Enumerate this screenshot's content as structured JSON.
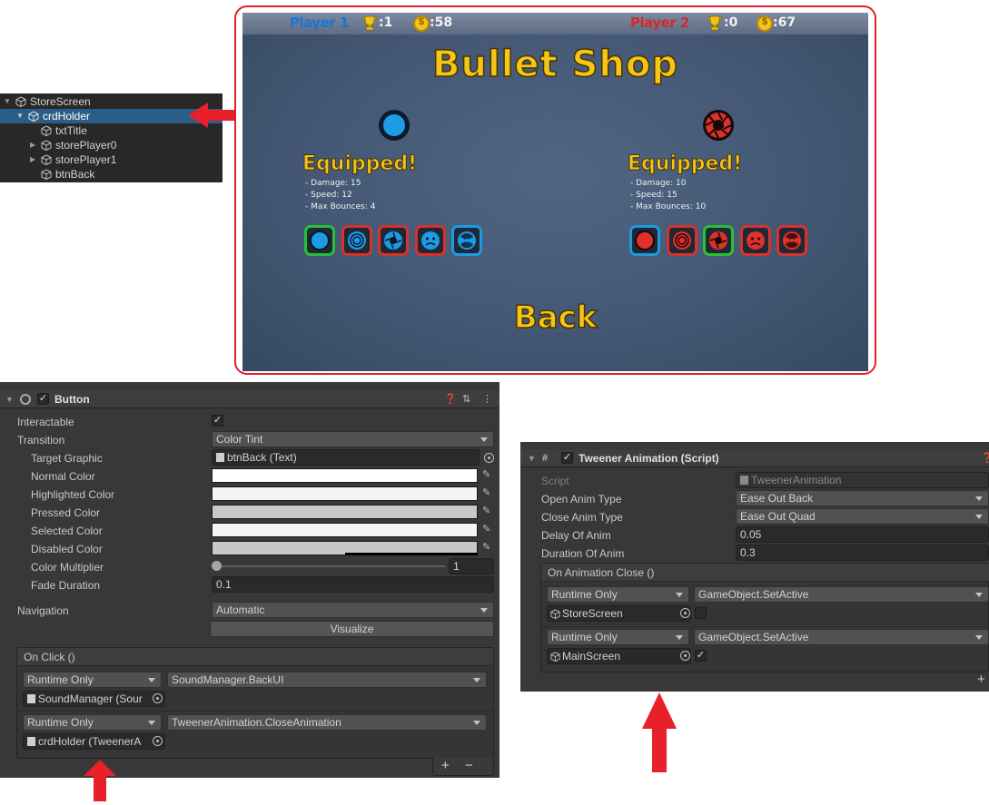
{
  "hierarchy": {
    "items": [
      {
        "label": "StoreScreen",
        "expanded": true
      },
      {
        "label": "crdHolder",
        "expanded": true,
        "selected": true
      },
      {
        "label": "txtTitle"
      },
      {
        "label": "storePlayer0",
        "collapsed": true
      },
      {
        "label": "storePlayer1",
        "collapsed": true
      },
      {
        "label": "btnBack"
      }
    ]
  },
  "game": {
    "player1": {
      "name": "Player 1",
      "trophies": ":1",
      "coins": ":58",
      "color": "#1b73d6"
    },
    "player2": {
      "name": "Player 2",
      "trophies": ":0",
      "coins": ":67",
      "color": "#d42a2a"
    },
    "title": "Bullet Shop",
    "left_panel": {
      "equipped": "Equipped!",
      "damage": "- Damage: 15",
      "speed": "- Speed: 12",
      "bounces": "- Max Bounces: 4"
    },
    "right_panel": {
      "equipped": "Equipped!",
      "damage": "- Damage: 10",
      "speed": "- Speed: 15",
      "bounces": "- Max Bounces: 10"
    },
    "back": "Back"
  },
  "button_component": {
    "title": "Button",
    "rows": {
      "interactable": "Interactable",
      "transition": "Transition",
      "transition_value": "Color Tint",
      "target_graphic": "Target Graphic",
      "target_graphic_value": "btnBack (Text)",
      "normal_color": "Normal Color",
      "highlighted_color": "Highlighted Color",
      "pressed_color": "Pressed Color",
      "selected_color": "Selected Color",
      "disabled_color": "Disabled Color",
      "color_multiplier": "Color Multiplier",
      "color_multiplier_value": "1",
      "fade_duration": "Fade Duration",
      "fade_duration_value": "0.1",
      "navigation": "Navigation",
      "navigation_value": "Automatic",
      "visualize": "Visualize"
    },
    "on_click": {
      "title": "On Click ()",
      "entries": [
        {
          "runtime": "Runtime Only",
          "function": "SoundManager.BackUI",
          "object": "SoundManager (Sour"
        },
        {
          "runtime": "Runtime Only",
          "function": "TweenerAnimation.CloseAnimation",
          "object": "crdHolder (TweenerA"
        }
      ],
      "add": "+",
      "remove": "−"
    }
  },
  "tweener_component": {
    "title": "Tweener Animation (Script)",
    "rows": {
      "script": "Script",
      "script_value": "TweenerAnimation",
      "open_anim_type": "Open Anim Type",
      "open_anim_type_value": "Ease Out Back",
      "close_anim_type": "Close Anim Type",
      "close_anim_type_value": "Ease Out Quad",
      "delay_of_anim": "Delay Of Anim",
      "delay_of_anim_value": "0.05",
      "duration_of_anim": "Duration Of Anim",
      "duration_of_anim_value": "0.3"
    },
    "on_close": {
      "title": "On Animation Close ()",
      "entries": [
        {
          "runtime": "Runtime Only",
          "function": "GameObject.SetActive",
          "object": "StoreScreen",
          "checked": false
        },
        {
          "runtime": "Runtime Only",
          "function": "GameObject.SetActive",
          "object": "MainScreen",
          "checked": true
        }
      ],
      "add": "+"
    }
  },
  "colors": {
    "accent_red": "#e8202a",
    "selection_blue": "#2c5d87",
    "gold": "#f5c518"
  }
}
